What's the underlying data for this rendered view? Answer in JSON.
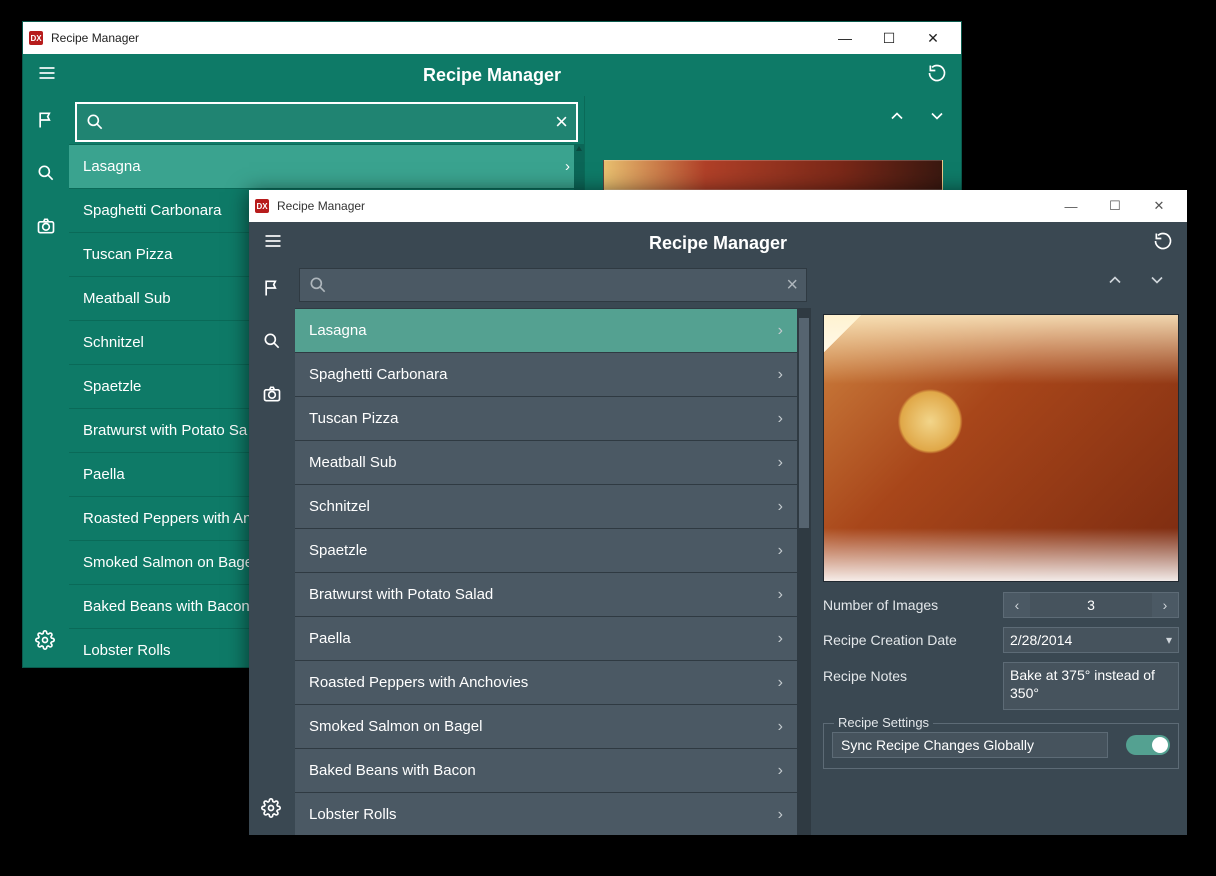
{
  "window1": {
    "titlebar": "Recipe Manager",
    "app_title": "Recipe Manager",
    "recipes": [
      "Lasagna",
      "Spaghetti Carbonara",
      "Tuscan Pizza",
      "Meatball Sub",
      "Schnitzel",
      "Spaetzle",
      "Bratwurst with Potato Sa",
      "Paella",
      "Roasted Peppers with An",
      "Smoked Salmon on Bage",
      "Baked Beans with Bacon",
      "Lobster Rolls"
    ],
    "selected_index": 0
  },
  "window2": {
    "titlebar": "Recipe Manager",
    "app_title": "Recipe Manager",
    "recipes": [
      "Lasagna",
      "Spaghetti Carbonara",
      "Tuscan Pizza",
      "Meatball Sub",
      "Schnitzel",
      "Spaetzle",
      "Bratwurst with Potato Salad",
      "Paella",
      "Roasted Peppers with Anchovies",
      "Smoked Salmon on Bagel",
      "Baked Beans with Bacon",
      "Lobster Rolls"
    ],
    "selected_index": 0,
    "details": {
      "num_images_label": "Number of Images",
      "num_images_value": "3",
      "creation_date_label": "Recipe Creation Date",
      "creation_date_value": "2/28/2014",
      "notes_label": "Recipe Notes",
      "notes_value": "Bake at 375° instead of 350°",
      "settings_legend": "Recipe Settings",
      "sync_label": "Sync Recipe Changes Globally",
      "sync_on": true
    }
  }
}
